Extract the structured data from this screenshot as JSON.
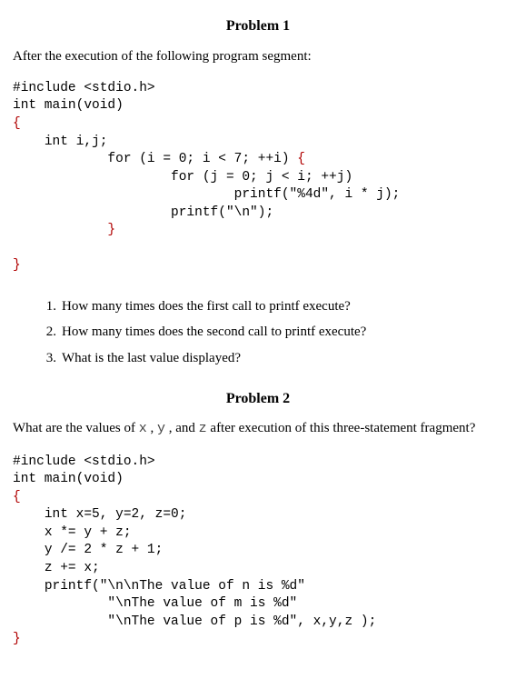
{
  "problem1": {
    "heading": "Problem 1",
    "intro": "After the execution of the following program segment:",
    "code_lines": [
      {
        "indent": 0,
        "segs": [
          {
            "t": "#include <stdio.h>",
            "c": "n"
          }
        ]
      },
      {
        "indent": 0,
        "segs": [
          {
            "t": "int main(void)",
            "c": "n"
          }
        ]
      },
      {
        "indent": 0,
        "segs": [
          {
            "t": "{",
            "c": "r"
          }
        ]
      },
      {
        "indent": 1,
        "segs": [
          {
            "t": "int i,j;",
            "c": "n"
          }
        ]
      },
      {
        "indent": 3,
        "segs": [
          {
            "t": "for (i = 0; i < 7; ++i) ",
            "c": "n"
          },
          {
            "t": "{",
            "c": "r"
          }
        ]
      },
      {
        "indent": 5,
        "segs": [
          {
            "t": "for (j = 0; j < i; ++j)",
            "c": "n"
          }
        ]
      },
      {
        "indent": 7,
        "segs": [
          {
            "t": "printf(\"%4d\", i * j);",
            "c": "n"
          }
        ]
      },
      {
        "indent": 5,
        "segs": [
          {
            "t": "printf(\"\\n\");",
            "c": "n"
          }
        ]
      },
      {
        "indent": 3,
        "segs": [
          {
            "t": "}",
            "c": "r"
          }
        ]
      },
      {
        "indent": 0,
        "segs": [
          {
            "t": "",
            "c": "n"
          }
        ]
      },
      {
        "indent": 0,
        "segs": [
          {
            "t": "}",
            "c": "r"
          }
        ]
      }
    ],
    "questions": [
      {
        "num": "1.",
        "text": "How many times does the first call to printf execute?"
      },
      {
        "num": "2.",
        "text": "How many times does the second call to printf execute?"
      },
      {
        "num": "3.",
        "text": "What is the last value displayed?"
      }
    ]
  },
  "problem2": {
    "heading": "Problem 2",
    "intro_pre": "What are the values of ",
    "intro_x": "x",
    "intro_c1": " , ",
    "intro_y": "y",
    "intro_c2": " , and ",
    "intro_z": "z",
    "intro_post": " after execution of this three-statement fragment?",
    "code_lines": [
      {
        "indent": 0,
        "segs": [
          {
            "t": "#include <stdio.h>",
            "c": "n"
          }
        ]
      },
      {
        "indent": 0,
        "segs": [
          {
            "t": "int main(void)",
            "c": "n"
          }
        ]
      },
      {
        "indent": 0,
        "segs": [
          {
            "t": "{",
            "c": "r"
          }
        ]
      },
      {
        "indent": 1,
        "segs": [
          {
            "t": "int x=5, y=2, z=0;",
            "c": "n"
          }
        ]
      },
      {
        "indent": 1,
        "segs": [
          {
            "t": "x *= y + z;",
            "c": "n"
          }
        ]
      },
      {
        "indent": 1,
        "segs": [
          {
            "t": "y /= 2 * z + 1;",
            "c": "n"
          }
        ]
      },
      {
        "indent": 1,
        "segs": [
          {
            "t": "z += x;",
            "c": "n"
          }
        ]
      },
      {
        "indent": 1,
        "segs": [
          {
            "t": "printf(\"\\n\\nThe value of n is %d\"",
            "c": "n"
          }
        ]
      },
      {
        "indent": 3,
        "segs": [
          {
            "t": "\"\\nThe value of m is %d\"",
            "c": "n"
          }
        ]
      },
      {
        "indent": 3,
        "segs": [
          {
            "t": "\"\\nThe value of p is %d\", x,y,z );",
            "c": "n"
          }
        ]
      },
      {
        "indent": 0,
        "segs": [
          {
            "t": "}",
            "c": "r"
          }
        ]
      }
    ]
  }
}
